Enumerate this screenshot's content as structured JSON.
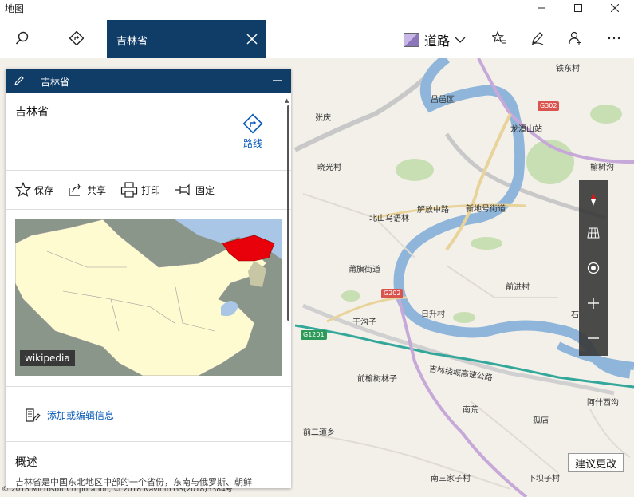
{
  "window": {
    "title": "地图"
  },
  "toolbar": {
    "search_value": "吉林省",
    "road_label": "道路"
  },
  "map": {
    "labels": [
      "铁东村",
      "昌邑区",
      "张庆",
      "龙潭山站",
      "晓光村",
      "榆树沟",
      "北山乌语林",
      "解放中路",
      "新地号街道",
      "前进村",
      "莆旗街道",
      "日升村",
      "干沟子",
      "前榆树林子",
      "吉林绕城高速公路",
      "阿什西沟",
      "南荒",
      "孤店",
      "前二道乡",
      "南三家子村",
      "下坝子村",
      "石"
    ],
    "shields": [
      "G302",
      "G202",
      "G1201"
    ],
    "suggest_label": "建议更改",
    "copyright": "© 2018 Microsoft Corporation, © 2018 Navinfo GS(2018)5384号"
  },
  "panel": {
    "header_title": "吉林省",
    "place_name": "吉林省",
    "route_label": "路线",
    "actions": {
      "save": "保存",
      "share": "共享",
      "print": "打印",
      "pin": "固定"
    },
    "image_source": "wikipedia",
    "edit_label": "添加或编辑信息",
    "overview_title": "概述",
    "overview_text": "吉林省是中国东北地区中部的一个省份，东南与俄罗斯、朝鲜"
  },
  "colors": {
    "header_blue": "#0f3d68",
    "link_blue": "#0a5bb8",
    "highlight_red": "#e8000b"
  }
}
